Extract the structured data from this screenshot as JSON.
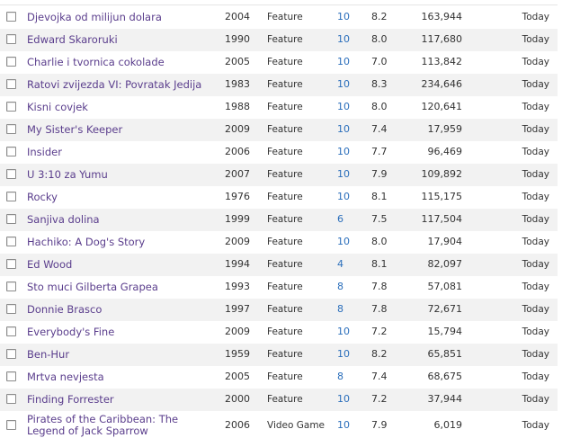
{
  "rows": [
    {
      "title": "Djevojka od milijun dolara",
      "year": "2004",
      "type": "Feature",
      "votes": "10",
      "rating": "8.2",
      "count": "163,944",
      "added": "Today"
    },
    {
      "title": "Edward Skaroruki",
      "year": "1990",
      "type": "Feature",
      "votes": "10",
      "rating": "8.0",
      "count": "117,680",
      "added": "Today"
    },
    {
      "title": "Charlie i tvornica cokolade",
      "year": "2005",
      "type": "Feature",
      "votes": "10",
      "rating": "7.0",
      "count": "113,842",
      "added": "Today"
    },
    {
      "title": "Ratovi zvijezda VI: Povratak Jedija",
      "year": "1983",
      "type": "Feature",
      "votes": "10",
      "rating": "8.3",
      "count": "234,646",
      "added": "Today"
    },
    {
      "title": "Kisni covjek",
      "year": "1988",
      "type": "Feature",
      "votes": "10",
      "rating": "8.0",
      "count": "120,641",
      "added": "Today"
    },
    {
      "title": "My Sister's Keeper",
      "year": "2009",
      "type": "Feature",
      "votes": "10",
      "rating": "7.4",
      "count": "17,959",
      "added": "Today"
    },
    {
      "title": "Insider",
      "year": "2006",
      "type": "Feature",
      "votes": "10",
      "rating": "7.7",
      "count": "96,469",
      "added": "Today"
    },
    {
      "title": "U 3:10 za Yumu",
      "year": "2007",
      "type": "Feature",
      "votes": "10",
      "rating": "7.9",
      "count": "109,892",
      "added": "Today"
    },
    {
      "title": "Rocky",
      "year": "1976",
      "type": "Feature",
      "votes": "10",
      "rating": "8.1",
      "count": "115,175",
      "added": "Today"
    },
    {
      "title": "Sanjiva dolina",
      "year": "1999",
      "type": "Feature",
      "votes": "6",
      "rating": "7.5",
      "count": "117,504",
      "added": "Today"
    },
    {
      "title": "Hachiko: A Dog's Story",
      "year": "2009",
      "type": "Feature",
      "votes": "10",
      "rating": "8.0",
      "count": "17,904",
      "added": "Today"
    },
    {
      "title": "Ed Wood",
      "year": "1994",
      "type": "Feature",
      "votes": "4",
      "rating": "8.1",
      "count": "82,097",
      "added": "Today"
    },
    {
      "title": "Sto muci Gilberta Grapea",
      "year": "1993",
      "type": "Feature",
      "votes": "8",
      "rating": "7.8",
      "count": "57,081",
      "added": "Today"
    },
    {
      "title": "Donnie Brasco",
      "year": "1997",
      "type": "Feature",
      "votes": "8",
      "rating": "7.8",
      "count": "72,671",
      "added": "Today"
    },
    {
      "title": "Everybody's Fine",
      "year": "2009",
      "type": "Feature",
      "votes": "10",
      "rating": "7.2",
      "count": "15,794",
      "added": "Today"
    },
    {
      "title": "Ben-Hur",
      "year": "1959",
      "type": "Feature",
      "votes": "10",
      "rating": "8.2",
      "count": "65,851",
      "added": "Today"
    },
    {
      "title": "Mrtva nevjesta",
      "year": "2005",
      "type": "Feature",
      "votes": "8",
      "rating": "7.4",
      "count": "68,675",
      "added": "Today"
    },
    {
      "title": "Finding Forrester",
      "year": "2000",
      "type": "Feature",
      "votes": "10",
      "rating": "7.2",
      "count": "37,944",
      "added": "Today"
    },
    {
      "title": "Pirates of the Caribbean: The Legend of Jack Sparrow",
      "year": "2006",
      "type": "Video Game",
      "votes": "10",
      "rating": "7.9",
      "count": "6,019",
      "added": "Today"
    }
  ]
}
